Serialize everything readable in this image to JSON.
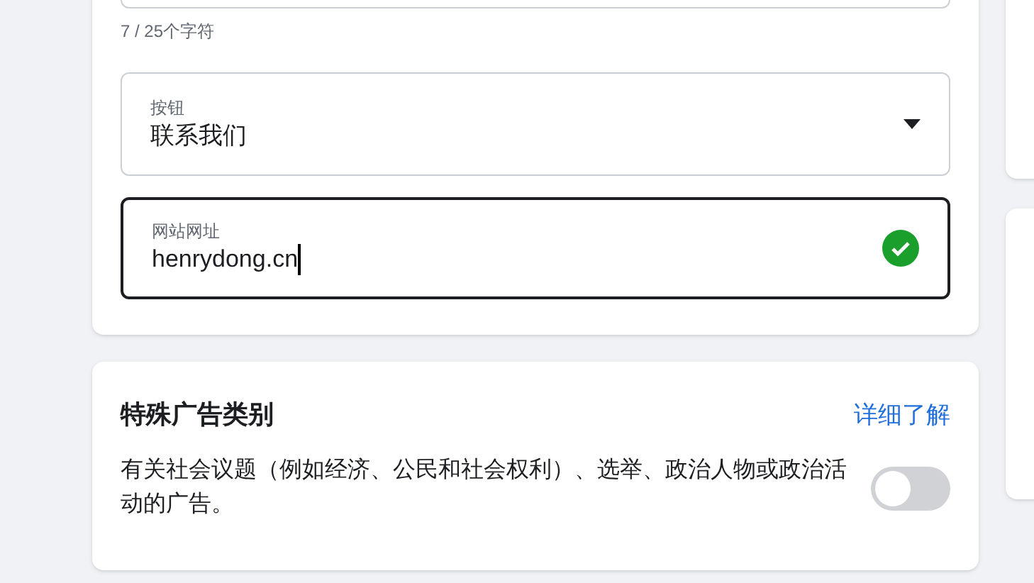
{
  "text_field": {
    "counter": "7 / 25个字符"
  },
  "button_select": {
    "label": "按钮",
    "value": "联系我们"
  },
  "website_field": {
    "label": "网站网址",
    "value": "henrydong.cn",
    "focused": true,
    "valid": true
  },
  "special_ad_category": {
    "title": "特殊广告类别",
    "link": "详细了解",
    "description": "有关社会议题（例如经济、公民和社会权利）、选举、政治人物或政治活动的广告。",
    "toggle": {
      "on": false
    }
  }
}
